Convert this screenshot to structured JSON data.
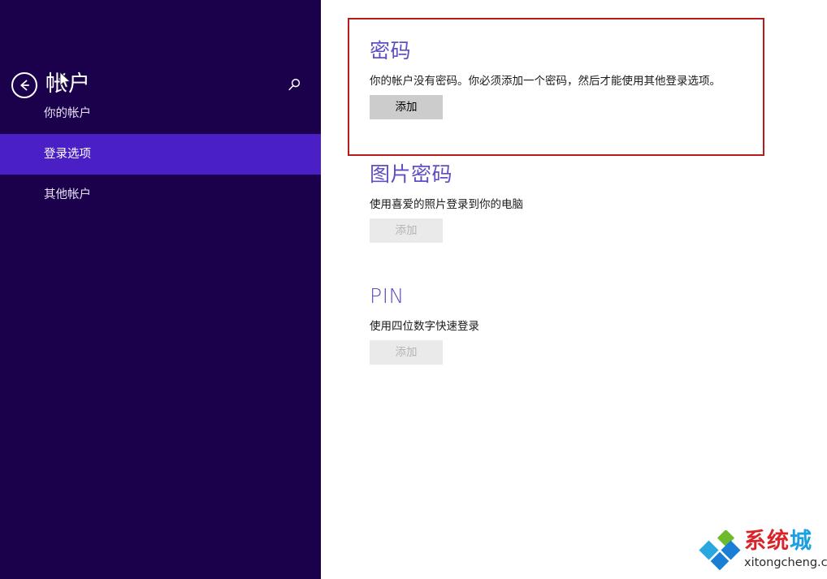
{
  "sidebar": {
    "title": "帐户",
    "back_icon": "back-arrow-circle-icon",
    "search_icon": "search-icon",
    "items": [
      {
        "label": "你的帐户",
        "selected": false
      },
      {
        "label": "登录选项",
        "selected": true
      },
      {
        "label": "其他帐户",
        "selected": false
      }
    ]
  },
  "content": {
    "sections": [
      {
        "title": "密码",
        "description": "你的帐户没有密码。你必须添加一个密码，然后才能使用其他登录选项。",
        "button_label": "添加",
        "button_disabled": false
      },
      {
        "title": "图片密码",
        "description": "使用喜爱的照片登录到你的电脑",
        "button_label": "添加",
        "button_disabled": true
      },
      {
        "title": "PIN",
        "description": "使用四位数字快速登录",
        "button_label": "添加",
        "button_disabled": true
      }
    ]
  },
  "annotation": {
    "name": "red-highlight-box",
    "color": "#b71c1c"
  },
  "watermark": {
    "brand_primary": "系统",
    "brand_secondary": "城",
    "domain": "xitongcheng.com",
    "logo_icon": "diamond-cluster-logo-icon",
    "logo_colors": {
      "green": "#6cba2e",
      "blue": "#1a7fd4",
      "cyan": "#29a8df"
    }
  },
  "colors": {
    "sidebar_bg": "#1b004c",
    "sidebar_selected_bg": "#4a1fc6",
    "section_title": "#5f4fc4",
    "button_active_bg": "#cccccc",
    "button_disabled_bg": "#eaeaea",
    "content_bg": "#ffffff"
  },
  "cursor": {
    "icon": "mouse-pointer-icon"
  }
}
